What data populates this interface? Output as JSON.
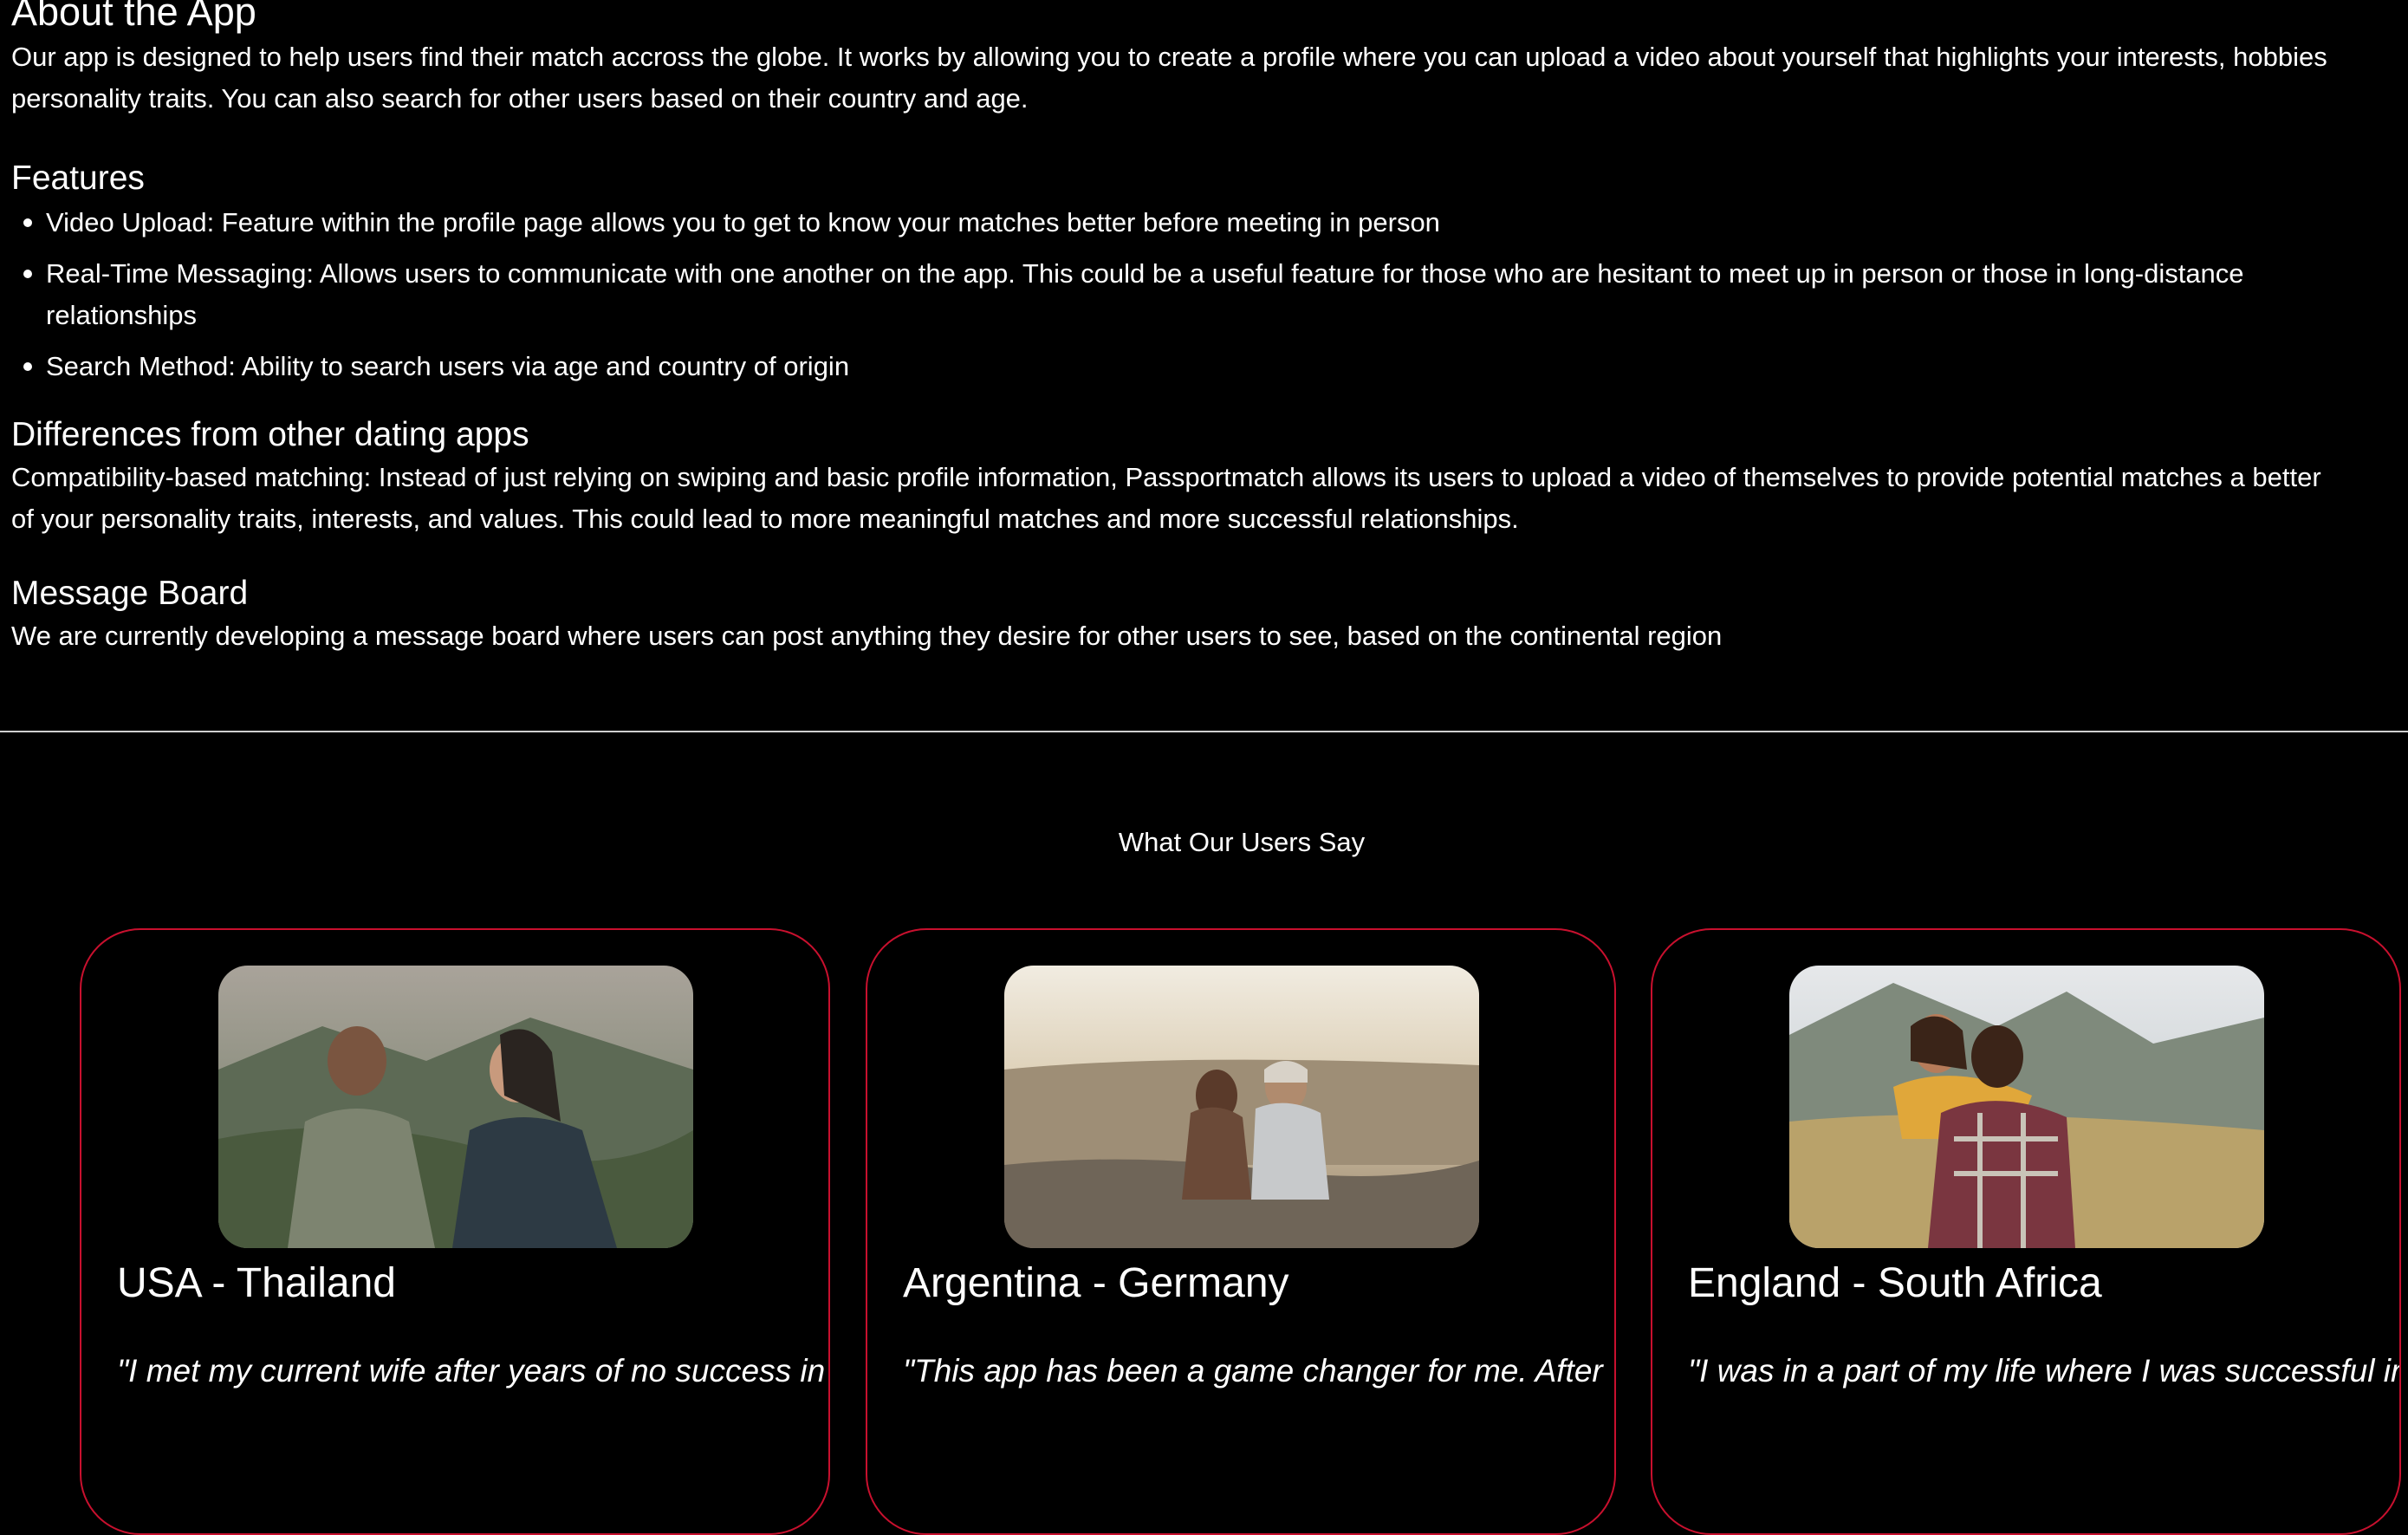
{
  "about": {
    "title": "About the App",
    "intro_line1": "Our app is designed to help users find their match accross the globe. It works by allowing you to create a profile where you can upload a video about yourself that highlights your interests, hobbies",
    "intro_line2": "personality traits. You can also search for other users based on their country and age."
  },
  "features": {
    "title": "Features",
    "items": [
      {
        "line1": "Video Upload: Feature within the profile page allows you to get to know your matches better before meeting in person",
        "line2": ""
      },
      {
        "line1": "Real-Time Messaging: Allows users to communicate with one another on the app. This could be a useful feature for those who are hesitant to meet up in person or those in long-distance",
        "line2": "relationships"
      },
      {
        "line1": "Search Method: Ability to search users via age and country of origin",
        "line2": ""
      }
    ]
  },
  "differences": {
    "title": "Differences from other dating apps",
    "line1": "Compatibility-based matching: Instead of just relying on swiping and basic profile information, Passportmatch allows its users to upload a video of themselves to provide potential matches a better",
    "line2": "of your personality traits, interests, and values. This could lead to more meaningful matches and more successful relationships."
  },
  "message_board": {
    "title": "Message Board",
    "text": "We are currently developing a message board where users can post anything they desire for other users to see, based on the continental region"
  },
  "testimonials": {
    "title": "What Our Users Say",
    "cards": [
      {
        "title": "USA - Thailand",
        "quote": "\"I met my current wife after years of no success in"
      },
      {
        "title": "Argentina - Germany",
        "quote": "\"This app has been a game changer for me. After"
      },
      {
        "title": "England - South Africa",
        "quote": "\"I was in a part of my life where I was successful in"
      }
    ]
  },
  "colors": {
    "background": "#000000",
    "text": "#ffffff",
    "card_border": "#c8102e",
    "divider": "#cfcfcf"
  }
}
